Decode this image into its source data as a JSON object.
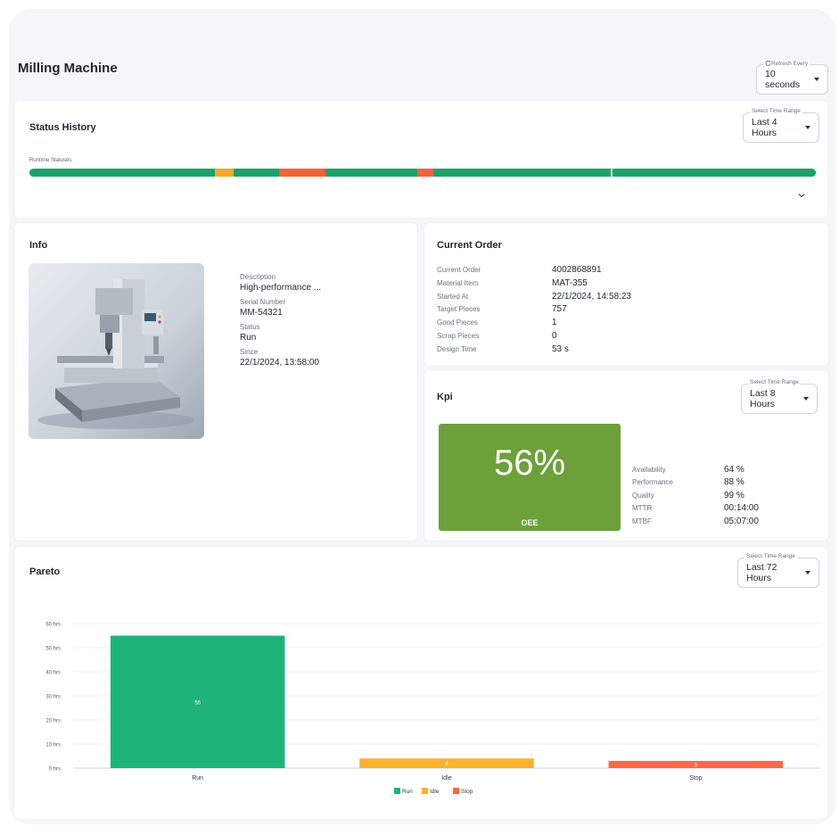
{
  "page": {
    "title": "Milling Machine"
  },
  "refresh": {
    "legend": "Refresh Every",
    "value": "10 seconds",
    "icon": "refresh-icon"
  },
  "status_history": {
    "title": "Status History",
    "range_legend": "Select Time Range",
    "range_value": "Last 4 Hours",
    "bar_label": "Runtime Statuses",
    "segments": [
      {
        "status": "run",
        "fraction": 0.236
      },
      {
        "status": "idle",
        "fraction": 0.024
      },
      {
        "status": "run",
        "fraction": 0.058
      },
      {
        "status": "stop",
        "fraction": 0.058
      },
      {
        "status": "run",
        "fraction": 0.117
      },
      {
        "status": "stop",
        "fraction": 0.021
      },
      {
        "status": "run",
        "fraction": 0.225
      },
      {
        "status": "unknown",
        "fraction": 0.003
      },
      {
        "status": "run",
        "fraction": 0.258
      }
    ]
  },
  "info": {
    "title": "Info",
    "fields": [
      {
        "label": "Description",
        "value": "High-performance ..."
      },
      {
        "label": "Serial Number",
        "value": "MM-54321"
      },
      {
        "label": "Status",
        "value": "Run"
      },
      {
        "label": "Since",
        "value": "22/1/2024, 13:58:00"
      }
    ]
  },
  "current_order": {
    "title": "Current Order",
    "fields": [
      {
        "label": "Current Order",
        "value": "4002868891"
      },
      {
        "label": "Material Item",
        "value": "MAT-355"
      },
      {
        "label": "Started At",
        "value": "22/1/2024, 14:58:23"
      },
      {
        "label": "Target Pieces",
        "value": "757"
      },
      {
        "label": "Good Pieces",
        "value": "1"
      },
      {
        "label": "Scrap Pieces",
        "value": "0"
      },
      {
        "label": "Design Time",
        "value": "53 s"
      }
    ]
  },
  "kpi": {
    "title": "Kpi",
    "range_legend": "Select Time Range",
    "range_value": "Last 8 Hours",
    "oee_value": "56%",
    "oee_label": "OEE",
    "metrics": [
      {
        "label": "Availability",
        "value": "64 %"
      },
      {
        "label": "Performance",
        "value": "88 %"
      },
      {
        "label": "Quality",
        "value": "99 %"
      },
      {
        "label": "MTTR",
        "value": "00:14:00"
      },
      {
        "label": "MTBF",
        "value": "05:07:00"
      }
    ]
  },
  "pareto": {
    "title": "Pareto",
    "range_legend": "Select Time Range",
    "range_value": "Last 72 Hours"
  },
  "colors": {
    "run": "#1aa46b",
    "idle": "#f7a928",
    "stop": "#f4623a",
    "unknown": "#d9d9d9",
    "oee": "#6ca03a"
  },
  "chart_data": {
    "type": "bar",
    "categories": [
      "Run",
      "Idle",
      "Stop"
    ],
    "values": [
      55,
      4,
      3
    ],
    "data_labels": [
      "55",
      "4",
      "3"
    ],
    "colors": [
      "#1db47a",
      "#fbb12b",
      "#fa6a43"
    ],
    "ylim": [
      0,
      60
    ],
    "yticks": [
      0,
      10,
      20,
      30,
      40,
      50,
      60
    ],
    "ytick_labels": [
      "0 hrs",
      "10 hrs",
      "20 hrs",
      "30 hrs",
      "40 hrs",
      "50 hrs",
      "60 hrs"
    ],
    "legend": [
      "Run",
      "Idle",
      "Stop"
    ],
    "legend_position": "bottom",
    "grid": true
  }
}
